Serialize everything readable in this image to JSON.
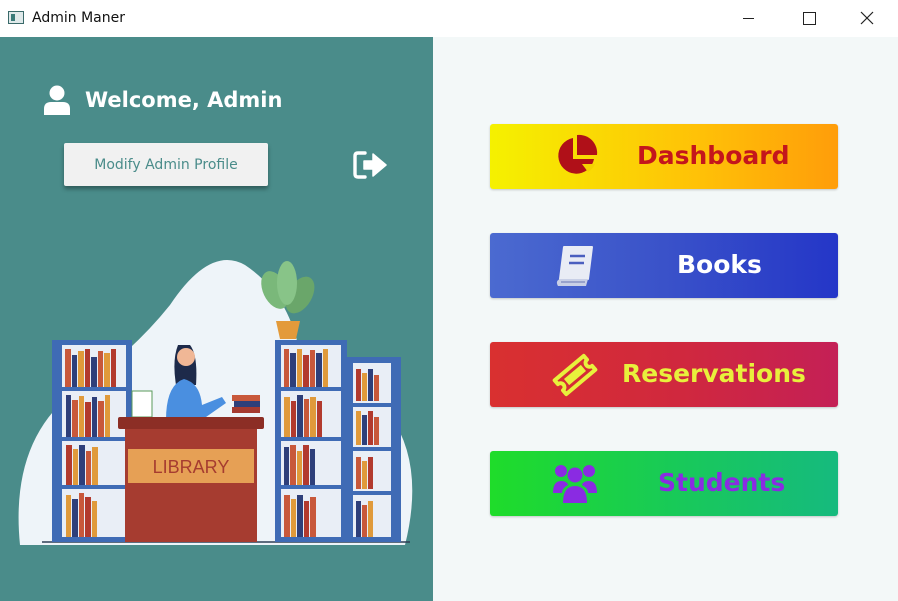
{
  "window": {
    "title": "Admin Maner"
  },
  "header": {
    "welcome_text": "Welcome, Admin",
    "modify_profile_label": "Modify Admin Profile"
  },
  "illustration": {
    "desk_sign": "LIBRARY"
  },
  "nav": {
    "dashboard_label": "Dashboard",
    "books_label": "Books",
    "reservations_label": "Reservations",
    "students_label": "Students"
  },
  "icons": {
    "user": "user-icon",
    "logout": "logout-icon",
    "dashboard": "pie-chart-icon",
    "books": "book-icon",
    "reservations": "ticket-icon",
    "students": "users-group-icon"
  },
  "colors": {
    "left_panel_bg": "#4a8c8a",
    "right_panel_bg": "#f3f8f8",
    "dashboard_text": "#c4161c",
    "books_text": "#ffffff",
    "reservations_text": "#e8f03c",
    "students_text": "#8a2be2"
  }
}
